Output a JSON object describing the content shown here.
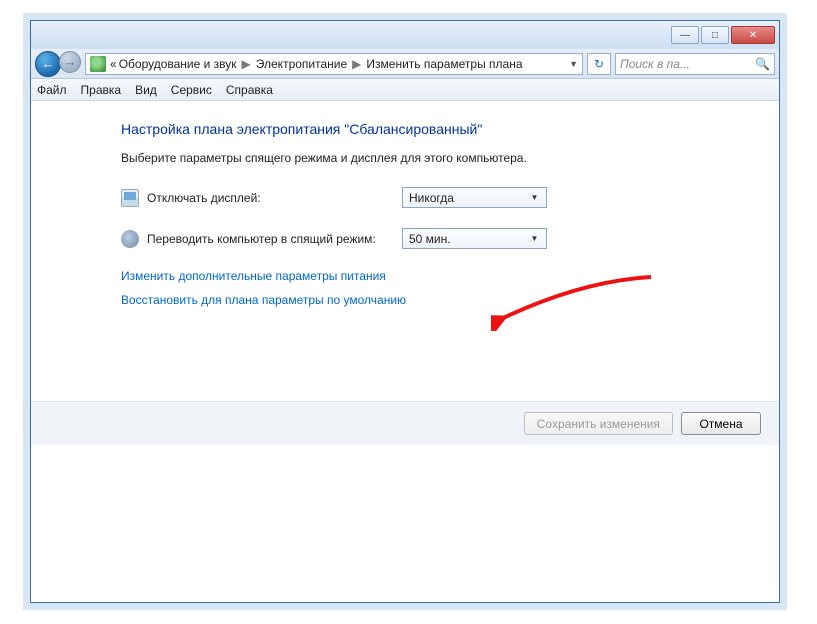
{
  "window": {
    "minimize_glyph": "—",
    "maximize_glyph": "□",
    "close_glyph": "✕"
  },
  "breadcrumb": {
    "prefix": "«",
    "items": [
      "Оборудование и звук",
      "Электропитание",
      "Изменить параметры плана"
    ]
  },
  "search": {
    "placeholder": "Поиск в па..."
  },
  "menu": {
    "file": "Файл",
    "edit": "Правка",
    "view": "Вид",
    "service": "Сервис",
    "help": "Справка"
  },
  "page": {
    "heading": "Настройка плана электропитания \"Сбалансированный\"",
    "subtext": "Выберите параметры спящего режима и дисплея для этого компьютера."
  },
  "settings": {
    "display_off_label": "Отключать дисплей:",
    "display_off_value": "Никогда",
    "sleep_label": "Переводить компьютер в спящий режим:",
    "sleep_value": "50 мин."
  },
  "links": {
    "advanced": "Изменить дополнительные параметры питания",
    "restore": "Восстановить для плана параметры по умолчанию"
  },
  "buttons": {
    "save": "Сохранить изменения",
    "cancel": "Отмена"
  }
}
